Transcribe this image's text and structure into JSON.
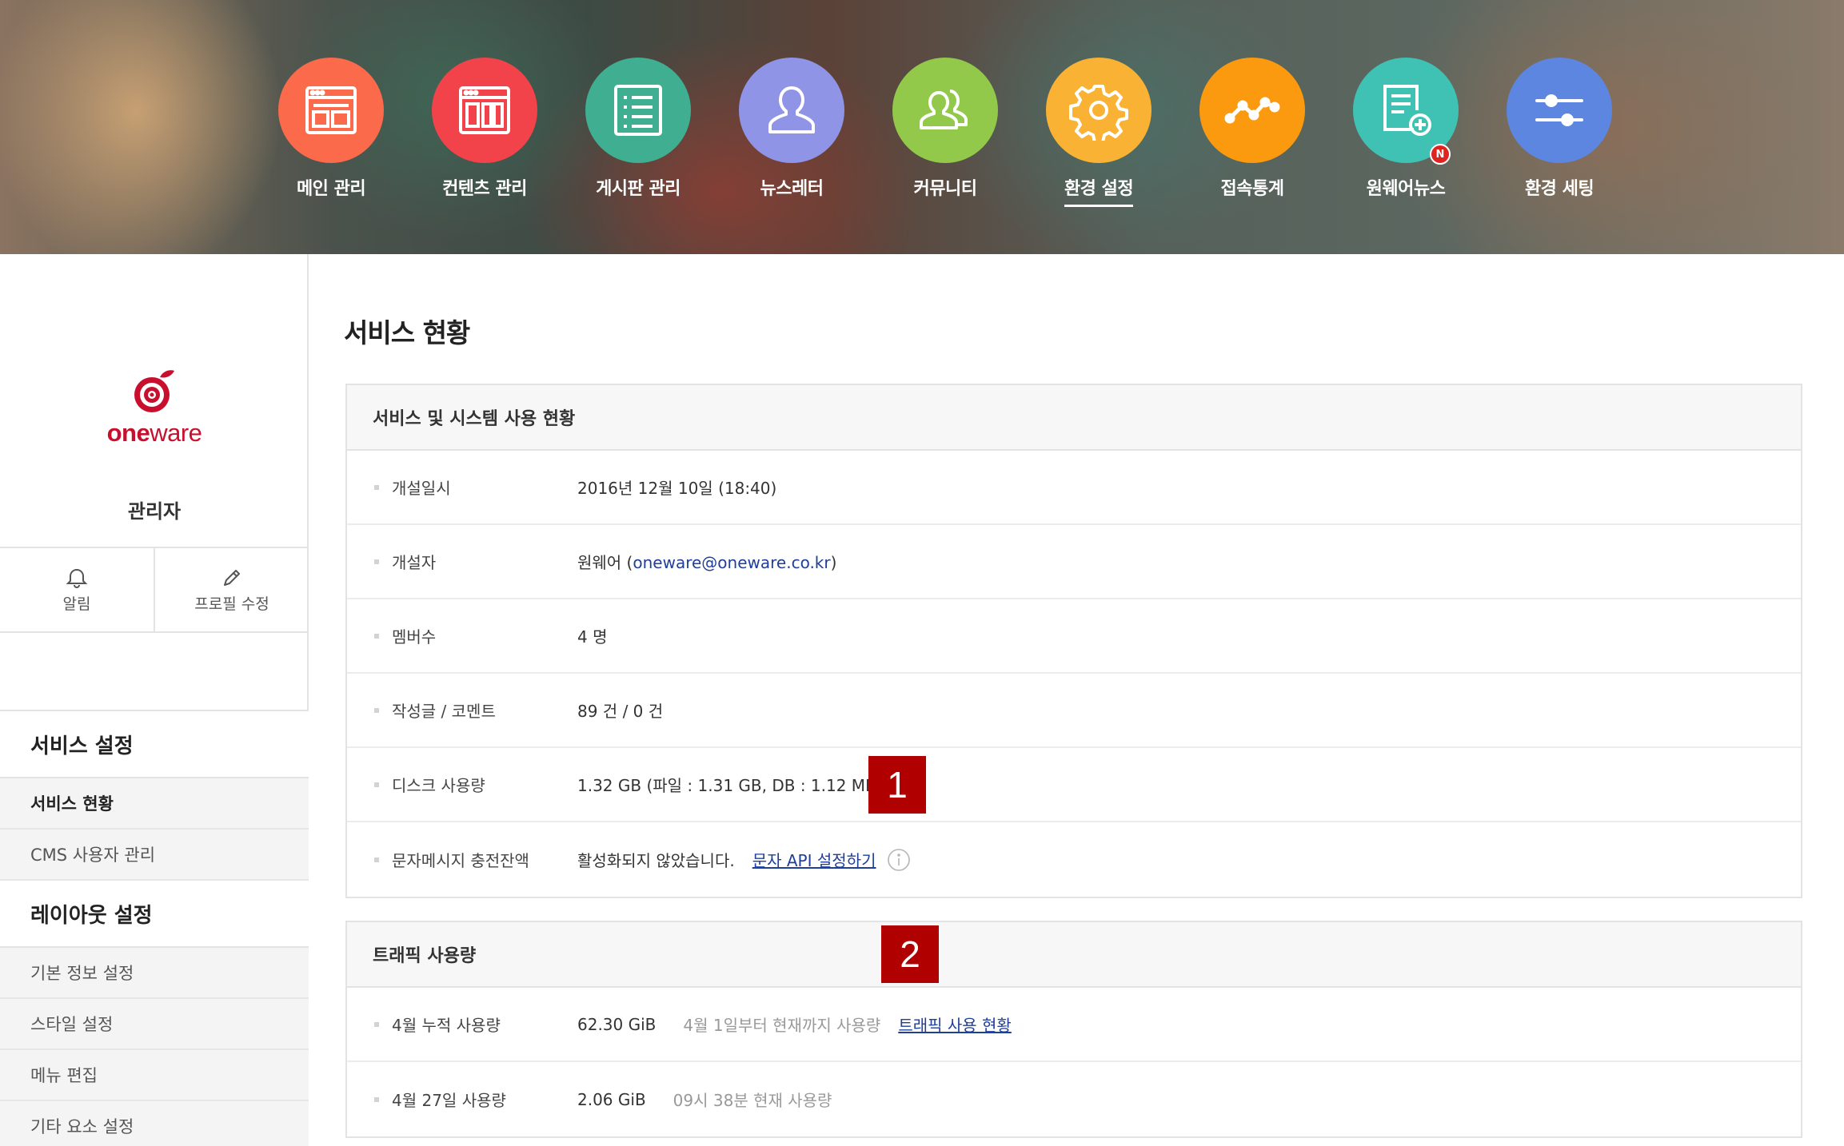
{
  "nav": {
    "items": [
      {
        "label": "메인 관리",
        "icon": "layout-icon",
        "color": "#fb6a4a"
      },
      {
        "label": "컨텐츠 관리",
        "icon": "content-icon",
        "color": "#f2434a"
      },
      {
        "label": "게시판 관리",
        "icon": "list-icon",
        "color": "#3fae91"
      },
      {
        "label": "뉴스레터",
        "icon": "person-icon",
        "color": "#8f94e6"
      },
      {
        "label": "커뮤니티",
        "icon": "people-icon",
        "color": "#92c94a"
      },
      {
        "label": "환경 설정",
        "icon": "gear-icon",
        "color": "#f9b233",
        "active": true
      },
      {
        "label": "접속통계",
        "icon": "line-chart-icon",
        "color": "#fb9a0e"
      },
      {
        "label": "원웨어뉴스",
        "icon": "add-document-icon",
        "color": "#3fc2b3",
        "badge": "N"
      },
      {
        "label": "환경 세팅",
        "icon": "sliders-icon",
        "color": "#5d86e0"
      }
    ]
  },
  "sidebar": {
    "logo_one": "one",
    "logo_ware": "ware",
    "admin_name": "관리자",
    "actions": {
      "alert": "알림",
      "edit_profile": "프로필 수정"
    },
    "sections": [
      {
        "title": "서비스 설정",
        "items": [
          "서비스 현황",
          "CMS 사용자 관리"
        ]
      },
      {
        "title": "레이아웃 설정",
        "items": [
          "기본 정보 설정",
          "스타일 설정",
          "메뉴 편집",
          "기타 요소 설정"
        ]
      }
    ]
  },
  "main": {
    "title": "서비스 현황",
    "service_panel": {
      "title": "서비스 및 시스템 사용 현황",
      "rows": {
        "created": {
          "label": "개설일시",
          "value": "2016년 12월 10일 (18:40)"
        },
        "creator": {
          "label": "개설자",
          "name": "원웨어 (",
          "email": "oneware@oneware.co.kr",
          "close": ")"
        },
        "members": {
          "label": "멤버수",
          "value": "4 명"
        },
        "posts": {
          "label": "작성글 / 코멘트",
          "value": "89 건 / 0 건"
        },
        "disk": {
          "label": "디스크 사용량",
          "value": "1.32 GB (파일 : 1.31 GB, DB : 1.12 MB)"
        },
        "sms": {
          "label": "문자메시지 충전잔액",
          "value": "활성화되지 않았습니다.",
          "link": "문자 API 설정하기"
        }
      }
    },
    "traffic_panel": {
      "title": "트래픽 사용량",
      "rows": {
        "monthly": {
          "label": "4월 누적 사용량",
          "value": "62.30 GiB",
          "note": "4월 1일부터 현재까지 사용량",
          "link": "트래픽 사용 현황"
        },
        "daily": {
          "label": "4월 27일 사용량",
          "value": "2.06 GiB",
          "note": "09시 38분 현재 사용량"
        }
      }
    },
    "markers": [
      "1",
      "2"
    ]
  }
}
